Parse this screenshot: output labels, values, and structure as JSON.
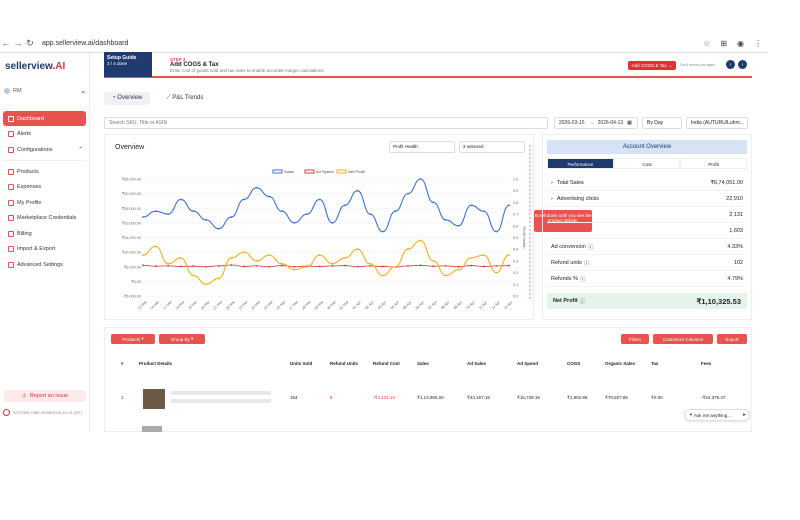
{
  "browser": {
    "url": "app.sellerview.ai/dashboard"
  },
  "sidebar": {
    "logo_main": "sellerview.",
    "logo_accent": "AI",
    "user_name": "RM",
    "items": [
      {
        "label": "Dashboard",
        "active": true
      },
      {
        "label": "Alerts"
      },
      {
        "label": "Configurations"
      },
      {
        "label": "Products"
      },
      {
        "label": "Expenses"
      },
      {
        "label": "My Profile"
      },
      {
        "label": "Marketplace Credentials"
      },
      {
        "label": "Billing"
      },
      {
        "label": "Import & Export"
      },
      {
        "label": "Advanced Settings"
      }
    ],
    "report": "Report an issue",
    "status": "SYSTEM TIME 09/05/2025 15:13 (IST)"
  },
  "banner": {
    "setup_title": "Setup Guide",
    "setup_line1": "3 / 4 done",
    "step_label": "STEP 3",
    "step_title": "Add COGS & Tax",
    "step_desc": "Enter cost of goods sold and tax rates to enable accurate margin calculations",
    "cta": "Add COGS & Tax →",
    "skip": "Don't remind me again"
  },
  "tabs": [
    {
      "label": "Overview"
    },
    {
      "label": "P&L Trends"
    }
  ],
  "filters": {
    "search_placeholder": "Search SKU, Title or ASIN",
    "date_from": "2026-03-15",
    "date_to": "2026-04-13",
    "granularity": "By Day",
    "market": "India (AUTURU/Luhm..."
  },
  "overview": {
    "title": "Overview",
    "metric_select": "Profit Health",
    "selected": "3 selected",
    "scroll_hint": "Scroll down until you see the product details."
  },
  "chart_data": {
    "type": "line",
    "legend": [
      "Sales",
      "Ad Spend",
      "Net Profit"
    ],
    "x": [
      "15 Mar",
      "16 Mar",
      "17 Mar",
      "18 Mar",
      "19 Mar",
      "20 Mar",
      "21 Mar",
      "22 Mar",
      "23 Mar",
      "24 Mar",
      "25 Mar",
      "26 Mar",
      "27 Mar",
      "28 Mar",
      "29 Mar",
      "30 Mar",
      "31 Mar",
      "01 Apr",
      "02 Apr",
      "03 Apr",
      "04 Apr",
      "05 Apr",
      "06 Apr",
      "07 Apr",
      "08 Apr",
      "09 Apr",
      "10 Apr",
      "11 Apr",
      "12 Apr",
      "13 Apr"
    ],
    "series": [
      {
        "name": "Sales",
        "color": "#3a73d8",
        "values": [
          22000,
          24000,
          23000,
          28000,
          24000,
          21000,
          18000,
          22000,
          28000,
          32000,
          29000,
          24000,
          20000,
          23000,
          28000,
          20000,
          26000,
          31000,
          23000,
          17000,
          24000,
          30000,
          35000,
          27000,
          21000,
          19000,
          26000,
          24000,
          17000,
          26000
        ]
      },
      {
        "name": "Ad Spend",
        "color": "#d33b3b",
        "values": [
          5500,
          5200,
          5300,
          5100,
          5200,
          5000,
          5300,
          5600,
          5100,
          5300,
          5000,
          5400,
          5000,
          5200,
          5100,
          5300,
          5400,
          5000,
          5300,
          5100,
          4900,
          5300,
          5500,
          5200,
          5300,
          5000,
          5400,
          5100,
          5300,
          5400
        ]
      },
      {
        "name": "Net Profit",
        "color": "#f0b020",
        "values": [
          9000,
          12000,
          6000,
          8000,
          2000,
          -1000,
          1000,
          8000,
          10000,
          7000,
          9000,
          6000,
          4000,
          5000,
          9000,
          6000,
          8000,
          11000,
          6000,
          2000,
          5000,
          11000,
          14000,
          7000,
          2000,
          4000,
          8000,
          9000,
          3000,
          9000
        ]
      }
    ],
    "yticks_left": [
      "₹35,000.00",
      "₹30,000.00",
      "₹25,000.00",
      "₹20,000.00",
      "₹15,000.00",
      "₹10,000.00",
      "₹5,000.00",
      "₹0.00",
      "-₹5,000.00"
    ],
    "yticks_right": [
      "1.0",
      "0.9",
      "0.8",
      "0.7",
      "0.6",
      "0.5",
      "0.4",
      "0.3",
      "0.2",
      "0.1",
      "0.0"
    ],
    "ylim": [
      -5000,
      35000
    ],
    "ylabel_right": "Profit Health"
  },
  "account": {
    "title": "Account Overview",
    "tabs": [
      "Performance",
      "Cost",
      "Profit"
    ],
    "rows": [
      {
        "label": "Total Sales",
        "value": "₹6,74,051.00"
      },
      {
        "label": "Advertising clicks",
        "value": "22,910"
      },
      {
        "label": "",
        "value": "2,131"
      },
      {
        "label": "",
        "value": "1,603"
      },
      {
        "label": "Ad conversion",
        "value": "4.33%"
      },
      {
        "label": "Refund units",
        "value": "102"
      },
      {
        "label": "Refunds %",
        "value": "4.79%"
      }
    ],
    "net_label": "Net Profit",
    "net_value": "₹1,10,325.53"
  },
  "table": {
    "btn_products": "Products",
    "btn_group": "Group By",
    "btn_filters": "Filters",
    "btn_columns": "Customize Columns",
    "btn_export": "Export",
    "headers": [
      "#",
      "Product Details",
      "Units Sold",
      "Refund Units",
      "Refund Cost",
      "Sales",
      "Ad Sales",
      "Ad Spend",
      "COGS",
      "Organic Sales",
      "Tax",
      "Fees"
    ],
    "row": [
      "1",
      "",
      "154",
      "8",
      "-₹4,131.14",
      "₹1,13,965.00",
      "₹43,157.15",
      "₹16,728.15",
      "₹1,902.86",
      "₹70,827.85",
      "₹0.00",
      "-₹24,376.47"
    ]
  },
  "askme": "Ask me anything..."
}
